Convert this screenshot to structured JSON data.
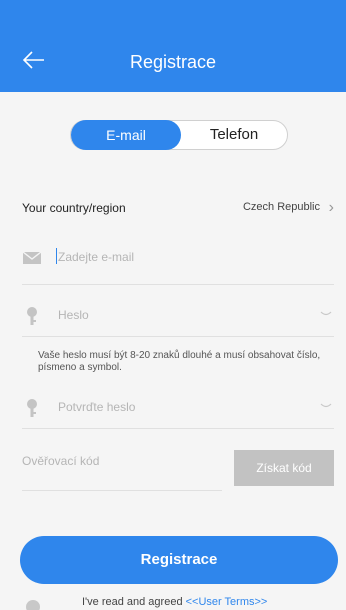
{
  "header": {
    "title": "Registrace"
  },
  "tabs": [
    {
      "label": "E-mail",
      "active": true
    },
    {
      "label": "Telefon",
      "active": false
    }
  ],
  "country": {
    "label": "Your country/region",
    "value": "Czech Republic"
  },
  "email": {
    "placeholder": "Zadejte e-mail",
    "icon": "envelope-icon"
  },
  "password": {
    "placeholder": "Heslo",
    "icon": "key-icon"
  },
  "password_hint": "Vaše heslo musí být 8-20 znaků dlouhé a musí obsahovat číslo, písmeno a symbol.",
  "confirm_password": {
    "placeholder": "Potvrďte heslo",
    "icon": "key-icon"
  },
  "verification": {
    "placeholder": "Ověřovací kód",
    "button_label": "Získat kód"
  },
  "submit_label": "Registrace",
  "terms": {
    "text": "I've read and agreed ",
    "link": "<<User Terms>>"
  },
  "colors": {
    "accent": "#2f86ec",
    "disabled": "#c2c2c2",
    "background": "#f5f5f5"
  }
}
